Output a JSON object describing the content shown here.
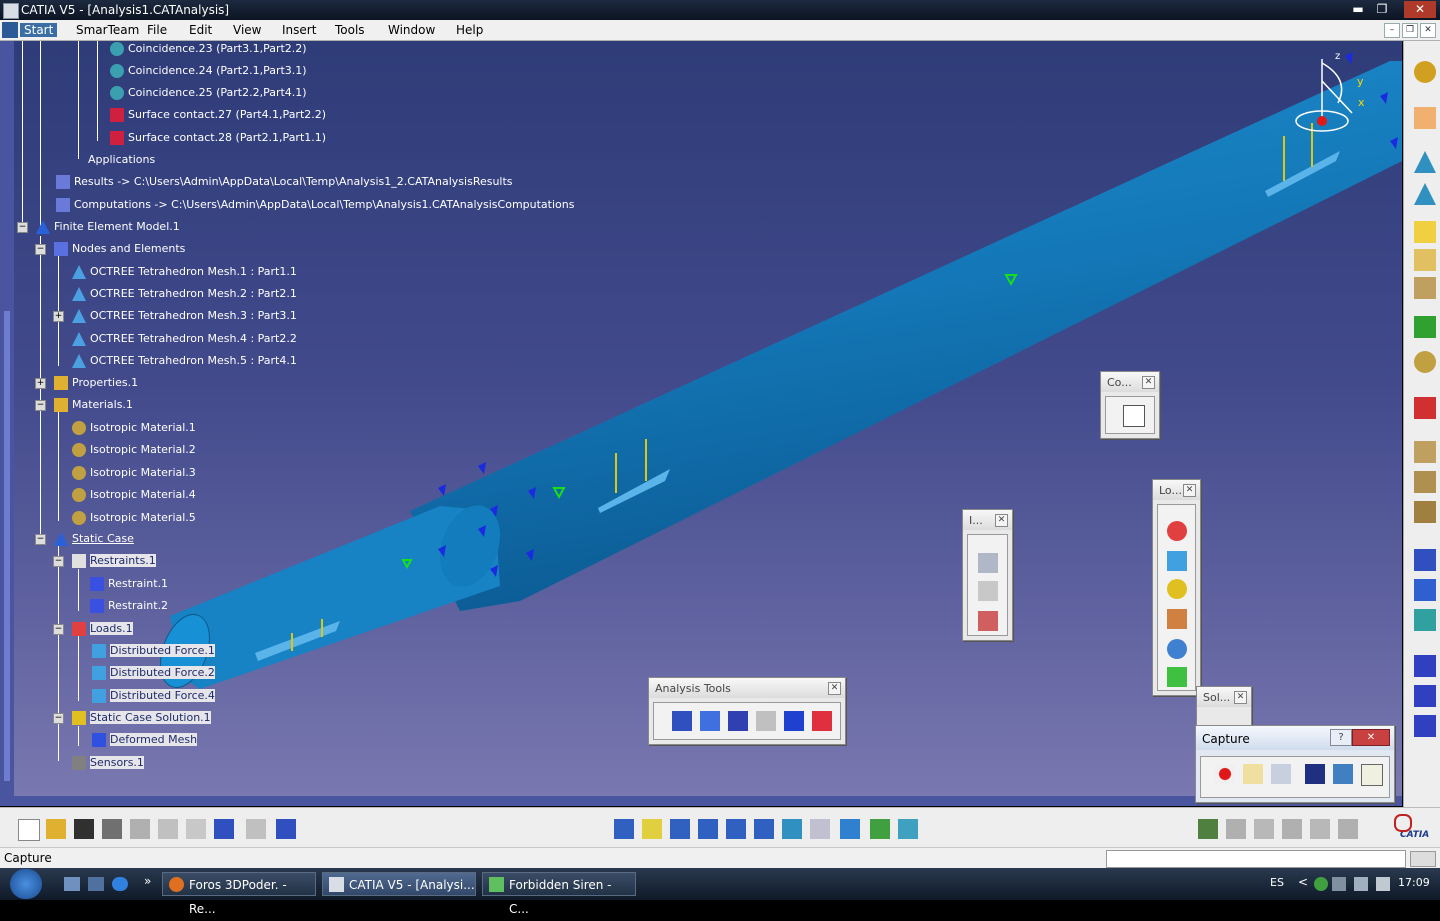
{
  "window": {
    "title": "CATIA V5 - [Analysis1.CATAnalysis]",
    "min": "▬",
    "max": "❐",
    "close": "✕"
  },
  "menu": {
    "items": [
      "Start",
      "SmarTeam",
      "File",
      "Edit",
      "View",
      "Insert",
      "Tools",
      "Window",
      "Help"
    ]
  },
  "tree": {
    "coincidence23": "Coincidence.23 (Part3.1,Part2.2)",
    "coincidence24": "Coincidence.24 (Part2.1,Part3.1)",
    "coincidence25": "Coincidence.25 (Part2.2,Part4.1)",
    "surface27": "Surface contact.27 (Part4.1,Part2.2)",
    "surface28": "Surface contact.28 (Part2.1,Part1.1)",
    "applications": "Applications",
    "results": "Results -> C:\\Users\\Admin\\AppData\\Local\\Temp\\Analysis1_2.CATAnalysisResults",
    "computations": "Computations -> C:\\Users\\Admin\\AppData\\Local\\Temp\\Analysis1.CATAnalysisComputations",
    "fem": "Finite Element Model.1",
    "nodes": "Nodes and Elements",
    "mesh1": "OCTREE Tetrahedron Mesh.1 : Part1.1",
    "mesh2": "OCTREE Tetrahedron Mesh.2 : Part2.1",
    "mesh3": "OCTREE Tetrahedron Mesh.3 : Part3.1",
    "mesh4": "OCTREE Tetrahedron Mesh.4 : Part2.2",
    "mesh5": "OCTREE Tetrahedron Mesh.5 : Part4.1",
    "properties": "Properties.1",
    "materials": "Materials.1",
    "iso1": "Isotropic Material.1",
    "iso2": "Isotropic Material.2",
    "iso3": "Isotropic Material.3",
    "iso4": "Isotropic Material.4",
    "iso5": "Isotropic Material.5",
    "staticcase": "Static Case",
    "restraints": "Restraints.1",
    "restraint1": "Restraint.1",
    "restraint2": "Restraint.2",
    "loads": "Loads.1",
    "df1": "Distributed Force.1",
    "df2": "Distributed Force.2",
    "df4": "Distributed Force.4",
    "solution": "Static Case Solution.1",
    "deformed": "Deformed Mesh",
    "sensors": "Sensors.1"
  },
  "axes": {
    "z": "z",
    "y": "y",
    "x": "x"
  },
  "toolbars": {
    "co": "Co...",
    "lo": "Lo...",
    "i": "I...",
    "sol": "Sol...",
    "analysis": "Analysis Tools",
    "capture": "Capture",
    "capture_help": "?"
  },
  "status": {
    "text": "Capture"
  },
  "taskbar": {
    "items": [
      "Foros 3DPoder. - Re...",
      "CATIA V5 - [Analysi...",
      "Forbidden Siren - C..."
    ],
    "more": "»",
    "lang": "ES",
    "arrow": "<",
    "time": "17:09"
  },
  "logo": {
    "text": "CATIA"
  }
}
